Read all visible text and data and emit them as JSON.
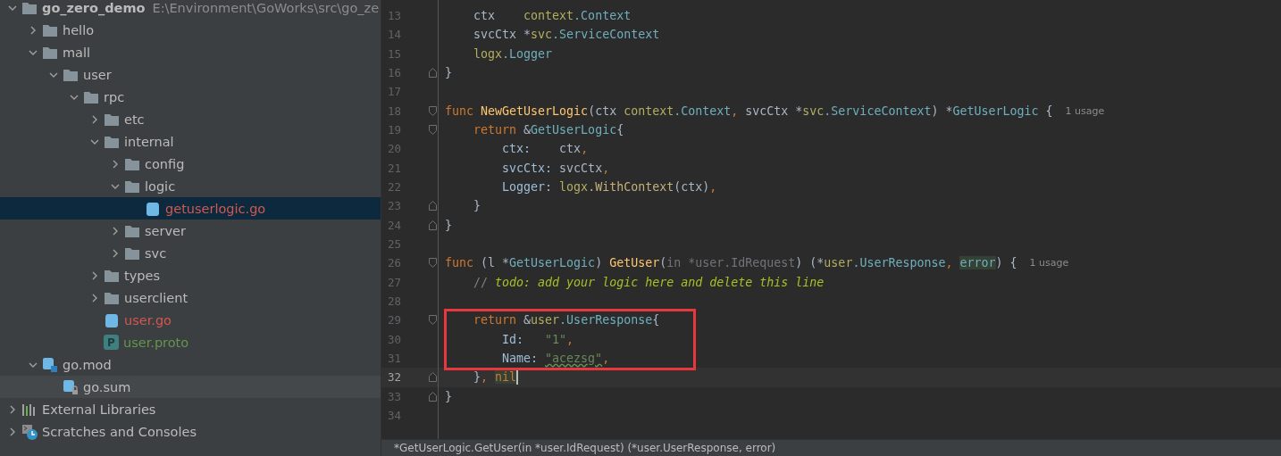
{
  "project_tree": {
    "items": [
      {
        "label": "go_zero_demo",
        "path": "E:\\Environment\\GoWorks\\src\\go_ze",
        "kind": "folder",
        "expanded": true,
        "selected": false,
        "children": [
          {
            "label": "hello",
            "kind": "folder",
            "expanded": false,
            "selected": false
          },
          {
            "label": "mall",
            "kind": "folder",
            "expanded": true,
            "selected": false,
            "children": [
              {
                "label": "user",
                "kind": "folder",
                "expanded": true,
                "selected": false,
                "children": [
                  {
                    "label": "rpc",
                    "kind": "folder",
                    "expanded": true,
                    "selected": false,
                    "children": [
                      {
                        "label": "etc",
                        "kind": "folder",
                        "expanded": false,
                        "selected": false
                      },
                      {
                        "label": "internal",
                        "kind": "folder",
                        "expanded": true,
                        "selected": false,
                        "children": [
                          {
                            "label": "config",
                            "kind": "folder",
                            "expanded": false,
                            "selected": false
                          },
                          {
                            "label": "logic",
                            "kind": "folder",
                            "expanded": true,
                            "selected": false,
                            "children": [
                              {
                                "label": "getuserlogic.go",
                                "kind": "go",
                                "color": "#d2584f",
                                "selected": true
                              }
                            ]
                          },
                          {
                            "label": "server",
                            "kind": "folder",
                            "expanded": false,
                            "selected": false
                          },
                          {
                            "label": "svc",
                            "kind": "folder",
                            "expanded": false,
                            "selected": false
                          }
                        ]
                      },
                      {
                        "label": "types",
                        "kind": "folder",
                        "expanded": false,
                        "selected": false
                      },
                      {
                        "label": "userclient",
                        "kind": "folder",
                        "expanded": false,
                        "selected": false
                      },
                      {
                        "label": "user.go",
                        "kind": "go",
                        "color": "#d2584f",
                        "selected": false
                      },
                      {
                        "label": "user.proto",
                        "kind": "proto",
                        "badge": "P",
                        "color": "#62964d",
                        "selected": false
                      }
                    ]
                  }
                ]
              }
            ]
          },
          {
            "label": "go.mod",
            "kind": "gomod",
            "expanded": true,
            "selected": false,
            "children": [
              {
                "label": "go.sum",
                "kind": "gosum",
                "hovered": true,
                "selected": false
              }
            ]
          }
        ]
      },
      {
        "label": "External Libraries",
        "kind": "library",
        "expanded": false,
        "selected": false
      },
      {
        "label": "Scratches and Consoles",
        "kind": "scratches",
        "expanded": false,
        "selected": false
      }
    ]
  },
  "editor": {
    "lines": [
      {
        "number": "13",
        "tokens": [
          {
            "text": "    ctx    ",
            "kind": "plain"
          },
          {
            "text": "context",
            "kind": "pkg"
          },
          {
            "text": ".Context",
            "kind": "type"
          }
        ]
      },
      {
        "number": "14",
        "tokens": [
          {
            "text": "    svcCtx *",
            "kind": "plain"
          },
          {
            "text": "svc",
            "kind": "pkg"
          },
          {
            "text": ".ServiceContext",
            "kind": "type"
          }
        ]
      },
      {
        "number": "15",
        "tokens": [
          {
            "text": "    logx",
            "kind": "pkg"
          },
          {
            "text": ".Logger",
            "kind": "type"
          }
        ]
      },
      {
        "number": "16",
        "fold_close": true,
        "tokens": [
          {
            "text": "}",
            "kind": "plain"
          }
        ]
      },
      {
        "number": "17"
      },
      {
        "number": "18",
        "fold_open": true,
        "tokens": [
          {
            "text": "func",
            "kind": "keyword"
          },
          {
            "text": " NewGetUserLogic",
            "kind": "func"
          },
          {
            "text": "(ctx ",
            "kind": "plain"
          },
          {
            "text": "context",
            "kind": "pkg"
          },
          {
            "text": ".Context",
            "kind": "type"
          },
          {
            "text": ", ",
            "kind": "keyword"
          },
          {
            "text": "svcCtx *",
            "kind": "plain"
          },
          {
            "text": "svc",
            "kind": "pkg"
          },
          {
            "text": ".ServiceContext",
            "kind": "type"
          },
          {
            "text": ") *",
            "kind": "plain"
          },
          {
            "text": "GetUserLogic",
            "kind": "type"
          },
          {
            "text": " {",
            "kind": "plain"
          },
          {
            "text": "1 usage",
            "kind": "hint"
          }
        ]
      },
      {
        "number": "19",
        "fold_open": true,
        "tokens": [
          {
            "text": "    return",
            "kind": "keyword"
          },
          {
            "text": " &",
            "kind": "plain"
          },
          {
            "text": "GetUserLogic",
            "kind": "type"
          },
          {
            "text": "{",
            "kind": "plain"
          }
        ]
      },
      {
        "number": "20",
        "tokens": [
          {
            "text": "        ctx:",
            "kind": "field"
          },
          {
            "text": "    ctx",
            "kind": "plain"
          },
          {
            "text": ",",
            "kind": "keyword"
          }
        ]
      },
      {
        "number": "21",
        "tokens": [
          {
            "text": "        svcCtx:",
            "kind": "field"
          },
          {
            "text": " svcCtx",
            "kind": "plain"
          },
          {
            "text": ",",
            "kind": "keyword"
          }
        ]
      },
      {
        "number": "22",
        "tokens": [
          {
            "text": "        Logger:",
            "kind": "field"
          },
          {
            "text": " logx",
            "kind": "pkg"
          },
          {
            "text": ".WithContext",
            "kind": "method"
          },
          {
            "text": "(ctx)",
            "kind": "plain"
          },
          {
            "text": ",",
            "kind": "keyword"
          }
        ]
      },
      {
        "number": "23",
        "fold_close": true,
        "tokens": [
          {
            "text": "    }",
            "kind": "plain"
          }
        ]
      },
      {
        "number": "24",
        "fold_close": true,
        "tokens": [
          {
            "text": "}",
            "kind": "plain"
          }
        ]
      },
      {
        "number": "25"
      },
      {
        "number": "26",
        "fold_open": true,
        "tokens": [
          {
            "text": "func",
            "kind": "keyword"
          },
          {
            "text": " (l *",
            "kind": "plain"
          },
          {
            "text": "GetUserLogic",
            "kind": "type"
          },
          {
            "text": ") ",
            "kind": "plain"
          },
          {
            "text": "GetUser",
            "kind": "func"
          },
          {
            "text": "(",
            "kind": "plain"
          },
          {
            "text": "in *user.IdRequest",
            "kind": "unused"
          },
          {
            "text": ") (*",
            "kind": "plain"
          },
          {
            "text": "user",
            "kind": "pkg"
          },
          {
            "text": ".UserResponse",
            "kind": "type"
          },
          {
            "text": ", ",
            "kind": "keyword"
          },
          {
            "text": "error",
            "kind": "type",
            "highlight": true
          },
          {
            "text": ") {",
            "kind": "plain"
          },
          {
            "text": "1 usage",
            "kind": "hint"
          }
        ]
      },
      {
        "number": "27",
        "tokens": [
          {
            "text": "    // ",
            "kind": "comment"
          },
          {
            "text": "todo: add your logic here and delete this line",
            "kind": "todo"
          }
        ]
      },
      {
        "number": "28"
      },
      {
        "number": "29",
        "fold_open": true,
        "boxed": true,
        "tokens": [
          {
            "text": "    return",
            "kind": "keyword"
          },
          {
            "text": " &",
            "kind": "plain"
          },
          {
            "text": "user",
            "kind": "pkg"
          },
          {
            "text": ".UserResponse",
            "kind": "type"
          },
          {
            "text": "{",
            "kind": "plain"
          }
        ]
      },
      {
        "number": "30",
        "boxed": true,
        "tokens": [
          {
            "text": "        Id:   ",
            "kind": "field"
          },
          {
            "text": "\"1\"",
            "kind": "string"
          },
          {
            "text": ",",
            "kind": "keyword"
          }
        ]
      },
      {
        "number": "31",
        "boxed": true,
        "tokens": [
          {
            "text": "        Name: ",
            "kind": "field"
          },
          {
            "text": "\"acezsg\"",
            "kind": "string",
            "typo": true
          },
          {
            "text": ",",
            "kind": "keyword"
          }
        ]
      },
      {
        "number": "32",
        "fold_close": true,
        "current": true,
        "caret": true,
        "tokens": [
          {
            "text": "    }",
            "kind": "plain"
          },
          {
            "text": ", ",
            "kind": "keyword"
          },
          {
            "text": "nil",
            "kind": "keyword",
            "highlight": true
          }
        ]
      },
      {
        "number": "33",
        "fold_close": true,
        "tokens": [
          {
            "text": "}",
            "kind": "plain"
          }
        ]
      },
      {
        "number": "34"
      }
    ]
  },
  "breadcrumb": "*GetUserLogic.GetUser(in *user.IdRequest) (*user.UserResponse, error)"
}
